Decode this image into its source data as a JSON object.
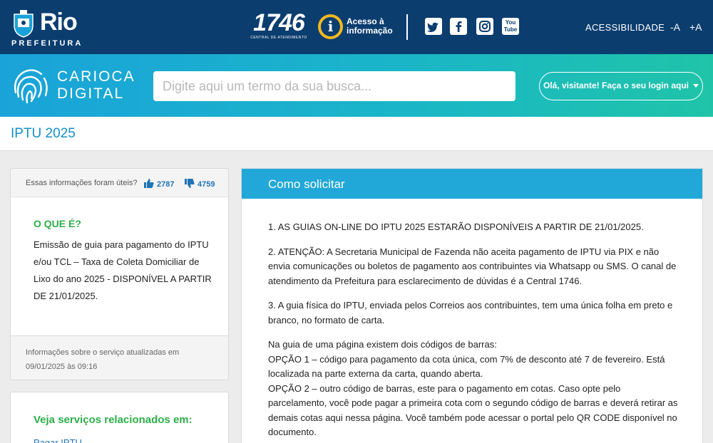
{
  "header": {
    "logo_text": "Rio",
    "logo_subtext": "PREFEITURA",
    "central_number": "1746",
    "central_subtext": "CENTRAL DE ATENDIMENTO",
    "acesso_line1": "Acesso à",
    "acesso_line2": "informação",
    "social": [
      "twitter-icon",
      "facebook-icon",
      "instagram-icon",
      "youtube-icon"
    ],
    "youtube_label": "You Tube",
    "accessibility_label": "ACESSIBILIDADE",
    "font_decrease": "-A",
    "font_increase": "+A"
  },
  "banner": {
    "brand_line1": "CARIOCA",
    "brand_line2": "DIGITAL",
    "search_placeholder": "Digite aqui um termo da sua busca...",
    "login_label": "Olá, visitante! Faça o seu login aqui"
  },
  "page": {
    "title": "IPTU 2025"
  },
  "feedback": {
    "question": "Essas informações foram úteis?",
    "likes": "2787",
    "dislikes": "4759"
  },
  "about": {
    "heading": "O QUE É?",
    "text": "Emissão de guia para pagamento do IPTU e/ou TCL – Taxa de Coleta Domiciliar de Lixo do ano 2025 - DISPONÍVEL A PARTIR DE 21/01/2025."
  },
  "updated": {
    "text": "Informações sobre o serviço atualizadas em 09/01/2025 às 09:16"
  },
  "related": {
    "heading": "Veja serviços relacionados em:",
    "link": "Pagar IPTU"
  },
  "main": {
    "heading": "Como solicitar",
    "p1": "1.  AS GUIAS ON-LINE DO IPTU 2025 ESTARÃO DISPONÍVEIS A PARTIR DE 21/01/2025.",
    "p2": "2.  ATENÇÃO: A Secretaria Municipal de Fazenda não aceita pagamento de IPTU via PIX e não envia comunicações ou boletos de pagamento aos contribuintes via Whatsapp ou SMS. O canal de atendimento da Prefeitura para esclarecimento de dúvidas é a Central 1746.",
    "p3": "3.  A guia física do IPTU, enviada pelos Correios aos contribuintes, tem uma única folha em preto e branco, no formato de carta.",
    "p4": "Na guia de uma página existem dois códigos de barras:",
    "p5": "OPÇÃO 1 – código para pagamento da cota única, com 7% de desconto até 7 de fevereiro. Está localizada na parte externa da carta, quando aberta.",
    "p6": "OPÇÃO 2 – outro código de barras, este para o pagamento em cotas. Caso opte pelo parcelamento, você pode pagar a primeira cota com o segundo código de barras e deverá retirar as demais cotas aqui nessa página. Você também pode acessar o portal pelo QR CODE disponível no documento."
  }
}
